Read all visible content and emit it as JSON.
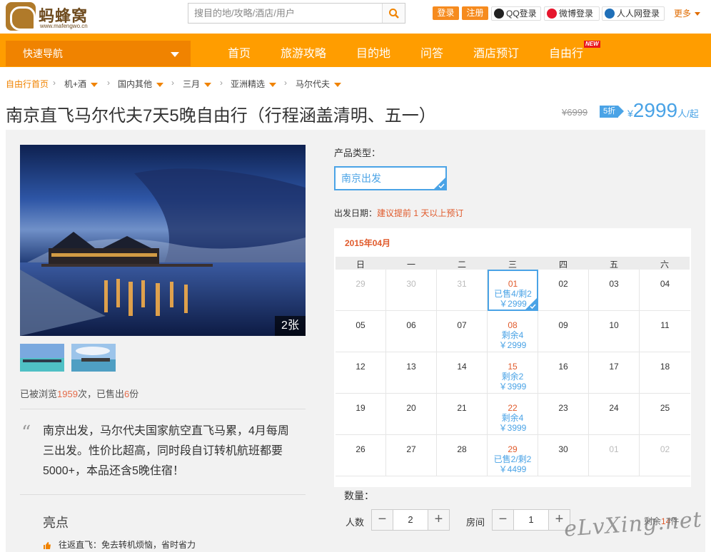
{
  "brand": {
    "logo_text": "蚂蜂窝",
    "logo_url": "www.mafengwo.cn"
  },
  "header": {
    "search_placeholder": "搜目的地/攻略/酒店/用户",
    "login": "登录",
    "register": "注册",
    "qq_login": "QQ登录",
    "weibo_login": "微博登录",
    "renren_login": "人人网登录",
    "more": "更多"
  },
  "nav": {
    "quick_nav": "快速导航",
    "items": [
      "首页",
      "旅游攻略",
      "目的地",
      "问答",
      "酒店预订",
      "自由行"
    ],
    "new_badge": "NEW"
  },
  "breadcrumb": [
    "自由行首页",
    "机+酒",
    "国内其他",
    "三月",
    "亚洲精选",
    "马尔代夫"
  ],
  "product": {
    "title": "南京直飞马尔代夫7天5晚自由行（行程涵盖清明、五一）",
    "old_price": "¥6999",
    "discount": "5折",
    "price_currency": "¥",
    "price": "2999",
    "price_unit": "人/起"
  },
  "gallery": {
    "count_label": "2张"
  },
  "stats": {
    "viewed_prefix": "已被浏览",
    "views": "1959",
    "viewed_mid": "次，已售出",
    "sold": "6",
    "sold_suffix": "份"
  },
  "description": "南京出发，马尔代夫国家航空直飞马累，4月每周三出发。性价比超高，同时段自订转机航班都要5000+，本品还含5晚住宿！",
  "highlights": {
    "heading": "亮点",
    "first": "往返直飞：免去转机烦恼，省时省力"
  },
  "booking": {
    "type_label": "产品类型：",
    "type_value": "南京出发",
    "date_label": "出发日期：",
    "date_hint": "建议提前 1 天以上预订",
    "month": "2015年04月",
    "weekdays": [
      "日",
      "一",
      "二",
      "三",
      "四",
      "五",
      "六"
    ],
    "weeks": [
      [
        {
          "d": "29",
          "m": true
        },
        {
          "d": "30",
          "m": true
        },
        {
          "d": "31",
          "m": true
        },
        {
          "d": "01",
          "a": true,
          "s": true,
          "l1": "已售4/剩2",
          "l2": "￥2999"
        },
        {
          "d": "02"
        },
        {
          "d": "03"
        },
        {
          "d": "04"
        }
      ],
      [
        {
          "d": "05"
        },
        {
          "d": "06"
        },
        {
          "d": "07"
        },
        {
          "d": "08",
          "a": true,
          "l1": "剩余4",
          "l2": "￥2999"
        },
        {
          "d": "09"
        },
        {
          "d": "10"
        },
        {
          "d": "11"
        }
      ],
      [
        {
          "d": "12"
        },
        {
          "d": "13"
        },
        {
          "d": "14"
        },
        {
          "d": "15",
          "a": true,
          "l1": "剩余2",
          "l2": "￥3999"
        },
        {
          "d": "16"
        },
        {
          "d": "17"
        },
        {
          "d": "18"
        }
      ],
      [
        {
          "d": "19"
        },
        {
          "d": "20"
        },
        {
          "d": "21"
        },
        {
          "d": "22",
          "a": true,
          "l1": "剩余4",
          "l2": "￥3999"
        },
        {
          "d": "23"
        },
        {
          "d": "24"
        },
        {
          "d": "25"
        }
      ],
      [
        {
          "d": "26"
        },
        {
          "d": "27"
        },
        {
          "d": "28"
        },
        {
          "d": "29",
          "a": true,
          "l1": "已售2/剩2",
          "l2": "￥4499"
        },
        {
          "d": "30"
        },
        {
          "d": "01",
          "m": true
        },
        {
          "d": "02",
          "m": true
        }
      ]
    ],
    "qty_label": "数量：",
    "persons_label": "人数",
    "persons_value": "2",
    "rooms_label": "房间",
    "rooms_value": "1",
    "remaining_prefix": "剩余",
    "remaining": "14",
    "remaining_suffix": "件",
    "minus": "−",
    "plus": "+"
  },
  "watermark": "eLvXing.net",
  "colors": {
    "brand_orange": "#ff9d00",
    "accent_blue": "#4aa3e6",
    "warn_red": "#e05a2b"
  }
}
